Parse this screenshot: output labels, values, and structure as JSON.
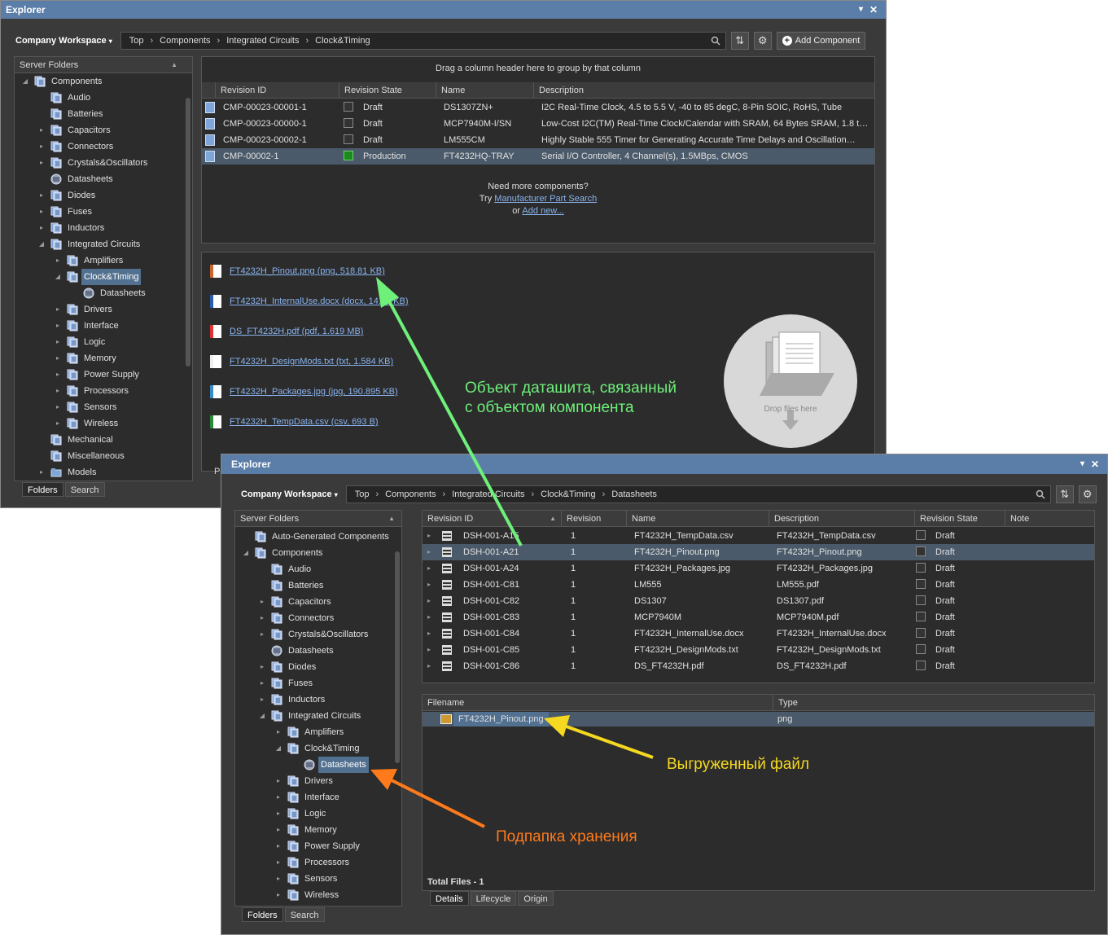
{
  "win1": {
    "title": "Explorer",
    "workspace": "Company Workspace",
    "breadcrumbs": [
      "Top",
      "Components",
      "Integrated Circuits",
      "Clock&Timing"
    ],
    "add_component": "Add Component",
    "server_folders_label": "Server Folders",
    "tree": [
      {
        "label": "Components",
        "level": 0,
        "arrow": "open",
        "icon": "folder-stack-icon"
      },
      {
        "label": "Audio",
        "level": 1,
        "arrow": "",
        "icon": "folder-stack-icon"
      },
      {
        "label": "Batteries",
        "level": 1,
        "arrow": "",
        "icon": "folder-stack-icon"
      },
      {
        "label": "Capacitors",
        "level": 1,
        "arrow": "closed",
        "icon": "folder-stack-icon"
      },
      {
        "label": "Connectors",
        "level": 1,
        "arrow": "closed",
        "icon": "folder-stack-icon"
      },
      {
        "label": "Crystals&Oscillators",
        "level": 1,
        "arrow": "closed",
        "icon": "folder-stack-icon"
      },
      {
        "label": "Datasheets",
        "level": 1,
        "arrow": "",
        "icon": "datasheet-icon"
      },
      {
        "label": "Diodes",
        "level": 1,
        "arrow": "closed",
        "icon": "folder-stack-icon"
      },
      {
        "label": "Fuses",
        "level": 1,
        "arrow": "closed",
        "icon": "folder-stack-icon"
      },
      {
        "label": "Inductors",
        "level": 1,
        "arrow": "closed",
        "icon": "folder-stack-icon"
      },
      {
        "label": "Integrated Circuits",
        "level": 1,
        "arrow": "open",
        "icon": "folder-stack-icon"
      },
      {
        "label": "Amplifiers",
        "level": 2,
        "arrow": "closed",
        "icon": "folder-stack-icon"
      },
      {
        "label": "Clock&Timing",
        "level": 2,
        "arrow": "open",
        "icon": "folder-stack-icon",
        "selected": true
      },
      {
        "label": "Datasheets",
        "level": 3,
        "arrow": "",
        "icon": "datasheet-icon"
      },
      {
        "label": "Drivers",
        "level": 2,
        "arrow": "closed",
        "icon": "folder-stack-icon"
      },
      {
        "label": "Interface",
        "level": 2,
        "arrow": "closed",
        "icon": "folder-stack-icon"
      },
      {
        "label": "Logic",
        "level": 2,
        "arrow": "closed",
        "icon": "folder-stack-icon"
      },
      {
        "label": "Memory",
        "level": 2,
        "arrow": "closed",
        "icon": "folder-stack-icon"
      },
      {
        "label": "Power Supply",
        "level": 2,
        "arrow": "closed",
        "icon": "folder-stack-icon"
      },
      {
        "label": "Processors",
        "level": 2,
        "arrow": "closed",
        "icon": "folder-stack-icon"
      },
      {
        "label": "Sensors",
        "level": 2,
        "arrow": "closed",
        "icon": "folder-stack-icon"
      },
      {
        "label": "Wireless",
        "level": 2,
        "arrow": "closed",
        "icon": "folder-stack-icon"
      },
      {
        "label": "Mechanical",
        "level": 1,
        "arrow": "",
        "icon": "folder-stack-icon"
      },
      {
        "label": "Miscellaneous",
        "level": 1,
        "arrow": "",
        "icon": "folder-stack-icon"
      },
      {
        "label": "Models",
        "level": 1,
        "arrow": "closed",
        "icon": "folder-icon"
      }
    ],
    "tabs": [
      "Folders",
      "Search"
    ],
    "group_hint": "Drag a column header here to group by that column",
    "columns": [
      "Revision ID",
      "Revision State",
      "Name",
      "Description"
    ],
    "rows": [
      {
        "id": "CMP-00023-00001-1",
        "state": "Draft",
        "name": "DS1307ZN+",
        "desc": "I2C Real-Time Clock, 4.5 to 5.5 V, -40 to 85 degC, 8-Pin SOIC, RoHS, Tube"
      },
      {
        "id": "CMP-00023-00000-1",
        "state": "Draft",
        "name": "MCP7940M-I/SN",
        "desc": "Low-Cost I2C(TM) Real-Time Clock/Calendar with SRAM, 64 Bytes SRAM, 1.8 t…"
      },
      {
        "id": "CMP-00023-00002-1",
        "state": "Draft",
        "name": "LM555CM",
        "desc": "Highly Stable 555 Timer for Generating Accurate Time Delays and Oscillation…"
      },
      {
        "id": "CMP-00002-1",
        "state": "Production",
        "name": "FT4232HQ-TRAY",
        "desc": "Serial I/O Controller, 4 Channel(s), 1.5MBps, CMOS",
        "selected": true
      }
    ],
    "need_more": "Need more components?",
    "try_text": "Try",
    "mps_link": "Manufacturer Part Search",
    "or_text": "or",
    "add_new_link": "Add new...",
    "files": [
      {
        "label": "FT4232H_Pinout.png (png, 518.81  KB)",
        "type": "png"
      },
      {
        "label": "FT4232H_InternalUse.docx (docx, 14.42  KB)",
        "type": "docx"
      },
      {
        "label": "DS_FT4232H.pdf (pdf, 1.619  MB)",
        "type": "pdf"
      },
      {
        "label": "FT4232H_DesignMods.txt (txt, 1.584  KB)",
        "type": "txt"
      },
      {
        "label": "FT4232H_Packages.jpg (jpg, 190.895  KB)",
        "type": "jpg"
      },
      {
        "label": "FT4232H_TempData.csv (csv, 693  B)",
        "type": "csv"
      }
    ],
    "drop_text": "Drop files here",
    "bottom_tab_fragment": "Pr"
  },
  "win2": {
    "title": "Explorer",
    "workspace": "Company Workspace",
    "breadcrumbs": [
      "Top",
      "Components",
      "Integrated Circuits",
      "Clock&Timing",
      "Datasheets"
    ],
    "server_folders_label": "Server Folders",
    "tree": [
      {
        "label": "Auto-Generated Components",
        "level": 0,
        "arrow": "",
        "icon": "folder-stack-icon"
      },
      {
        "label": "Components",
        "level": 0,
        "arrow": "open",
        "icon": "folder-stack-icon"
      },
      {
        "label": "Audio",
        "level": 1,
        "arrow": "",
        "icon": "folder-stack-icon"
      },
      {
        "label": "Batteries",
        "level": 1,
        "arrow": "",
        "icon": "folder-stack-icon"
      },
      {
        "label": "Capacitors",
        "level": 1,
        "arrow": "closed",
        "icon": "folder-stack-icon"
      },
      {
        "label": "Connectors",
        "level": 1,
        "arrow": "closed",
        "icon": "folder-stack-icon"
      },
      {
        "label": "Crystals&Oscillators",
        "level": 1,
        "arrow": "closed",
        "icon": "folder-stack-icon"
      },
      {
        "label": "Datasheets",
        "level": 1,
        "arrow": "",
        "icon": "datasheet-icon"
      },
      {
        "label": "Diodes",
        "level": 1,
        "arrow": "closed",
        "icon": "folder-stack-icon"
      },
      {
        "label": "Fuses",
        "level": 1,
        "arrow": "closed",
        "icon": "folder-stack-icon"
      },
      {
        "label": "Inductors",
        "level": 1,
        "arrow": "closed",
        "icon": "folder-stack-icon"
      },
      {
        "label": "Integrated Circuits",
        "level": 1,
        "arrow": "open",
        "icon": "folder-stack-icon"
      },
      {
        "label": "Amplifiers",
        "level": 2,
        "arrow": "closed",
        "icon": "folder-stack-icon"
      },
      {
        "label": "Clock&Timing",
        "level": 2,
        "arrow": "open",
        "icon": "folder-stack-icon"
      },
      {
        "label": "Datasheets",
        "level": 3,
        "arrow": "",
        "icon": "datasheet-icon",
        "selected": true
      },
      {
        "label": "Drivers",
        "level": 2,
        "arrow": "closed",
        "icon": "folder-stack-icon"
      },
      {
        "label": "Interface",
        "level": 2,
        "arrow": "closed",
        "icon": "folder-stack-icon"
      },
      {
        "label": "Logic",
        "level": 2,
        "arrow": "closed",
        "icon": "folder-stack-icon"
      },
      {
        "label": "Memory",
        "level": 2,
        "arrow": "closed",
        "icon": "folder-stack-icon"
      },
      {
        "label": "Power Supply",
        "level": 2,
        "arrow": "closed",
        "icon": "folder-stack-icon"
      },
      {
        "label": "Processors",
        "level": 2,
        "arrow": "closed",
        "icon": "folder-stack-icon"
      },
      {
        "label": "Sensors",
        "level": 2,
        "arrow": "closed",
        "icon": "folder-stack-icon"
      },
      {
        "label": "Wireless",
        "level": 2,
        "arrow": "closed",
        "icon": "folder-stack-icon"
      }
    ],
    "tabs": [
      "Folders",
      "Search"
    ],
    "columns": [
      "Revision ID",
      "Revision",
      "Name",
      "Description",
      "Revision State",
      "Note"
    ],
    "rows": [
      {
        "id": "DSH-001-A15",
        "rev": "1",
        "name": "FT4232H_TempData.csv",
        "desc": "FT4232H_TempData.csv",
        "state": "Draft"
      },
      {
        "id": "DSH-001-A21",
        "rev": "1",
        "name": "FT4232H_Pinout.png",
        "desc": "FT4232H_Pinout.png",
        "state": "Draft",
        "selected": true
      },
      {
        "id": "DSH-001-A24",
        "rev": "1",
        "name": "FT4232H_Packages.jpg",
        "desc": "FT4232H_Packages.jpg",
        "state": "Draft"
      },
      {
        "id": "DSH-001-C81",
        "rev": "1",
        "name": "LM555",
        "desc": "LM555.pdf",
        "state": "Draft"
      },
      {
        "id": "DSH-001-C82",
        "rev": "1",
        "name": "DS1307",
        "desc": "DS1307.pdf",
        "state": "Draft"
      },
      {
        "id": "DSH-001-C83",
        "rev": "1",
        "name": "MCP7940M",
        "desc": "MCP7940M.pdf",
        "state": "Draft"
      },
      {
        "id": "DSH-001-C84",
        "rev": "1",
        "name": "FT4232H_InternalUse.docx",
        "desc": "FT4232H_InternalUse.docx",
        "state": "Draft"
      },
      {
        "id": "DSH-001-C85",
        "rev": "1",
        "name": "FT4232H_DesignMods.txt",
        "desc": "FT4232H_DesignMods.txt",
        "state": "Draft"
      },
      {
        "id": "DSH-001-C86",
        "rev": "1",
        "name": "DS_FT4232H.pdf",
        "desc": "DS_FT4232H.pdf",
        "state": "Draft"
      }
    ],
    "file_columns": [
      "Filename",
      "Type"
    ],
    "file_rows": [
      {
        "name": "FT4232H_Pinout.png",
        "type": "png"
      }
    ],
    "total_files": "Total Files - 1",
    "detail_tabs": [
      "Details",
      "Lifecycle",
      "Origin"
    ]
  },
  "annotations": {
    "green": "Объект даташита, связанный\nс объектом компонента",
    "yellow": "Выгруженный файл",
    "orange": "Подпапка хранения"
  },
  "colors": {
    "titlebar": "#5b7ea8",
    "selection": "#52708f",
    "link": "#8ab4f0",
    "green_arrow": "#6ef07a",
    "yellow_arrow": "#f5d820",
    "orange_arrow": "#ff7a1a",
    "production": "#1a8a1a"
  }
}
